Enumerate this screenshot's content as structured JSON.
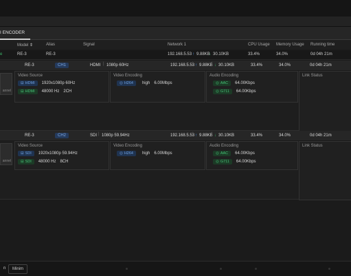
{
  "tab": {
    "label": "I ENCODER"
  },
  "columns": {
    "model": "Model",
    "model_sort": "⇕",
    "alias": "Alias",
    "signal": "Signal",
    "network": "Network 1",
    "cpu": "CPU Usage",
    "memory": "Memory Usage",
    "runtime": "Running time"
  },
  "summary": {
    "status": "e",
    "model": "RE-3",
    "alias": "RE-3",
    "ip": "192.168.5.53",
    "up": "9.88KB",
    "down": "30.10KB",
    "cpu": "33.4%",
    "memory": "34.0%",
    "runtime": "0d 04h 21m"
  },
  "channels": [
    {
      "model": "RE-3",
      "ch": "CH1",
      "signal_type": "HDMI",
      "signal_fmt": "1080p 60Hz",
      "ip": "192.168.5.53",
      "up": "9.88KB",
      "down": "30.10KB",
      "cpu": "33.4%",
      "memory": "34.0%",
      "runtime": "0d 04h 21m",
      "thumb_label": "annel",
      "video_source": {
        "title": "Video Source",
        "badge1": "HDMI",
        "res": "1920x1080p 60Hz",
        "badge2": "HDMI",
        "audio": "48000 Hz",
        "channels": "2CH"
      },
      "video_encoding": {
        "title": "Video Encoding",
        "codec": "H264",
        "profile": "high",
        "bitrate": "6.00Mbps"
      },
      "audio_encoding": {
        "title": "Audio Encoding",
        "codec1": "AAC",
        "br1": "64.00Kbps",
        "codec2": "G711",
        "br2": "64.00Kbps"
      },
      "link_status": {
        "title": "Link Status"
      }
    },
    {
      "model": "RE-3",
      "ch": "CH2",
      "signal_type": "SDI",
      "signal_fmt": "1080p 59.94Hz",
      "ip": "192.168.5.53",
      "up": "9.88KB",
      "down": "30.10KB",
      "cpu": "33.4%",
      "memory": "34.0%",
      "runtime": "0d 04h 21m",
      "thumb_label": "annel",
      "video_source": {
        "title": "Video Source",
        "badge1": "SDI",
        "res": "1920x1080p 59.94Hz",
        "badge2": "SDI",
        "audio": "48000 Hz",
        "channels": "8CH"
      },
      "video_encoding": {
        "title": "Video Encoding",
        "codec": "H264",
        "profile": "high",
        "bitrate": "6.00Mbps"
      },
      "audio_encoding": {
        "title": "Audio Encoding",
        "codec1": "AAC",
        "br1": "64.00Kbps",
        "codec2": "G711",
        "br2": "64.00Kbps"
      },
      "link_status": {
        "title": "Link Status"
      }
    }
  ],
  "bottom": {
    "tab1": "n",
    "tab2": "Minim"
  },
  "icons": {
    "up": "arrow-up-icon",
    "down": "arrow-down-icon",
    "sort": "sort-icon"
  }
}
